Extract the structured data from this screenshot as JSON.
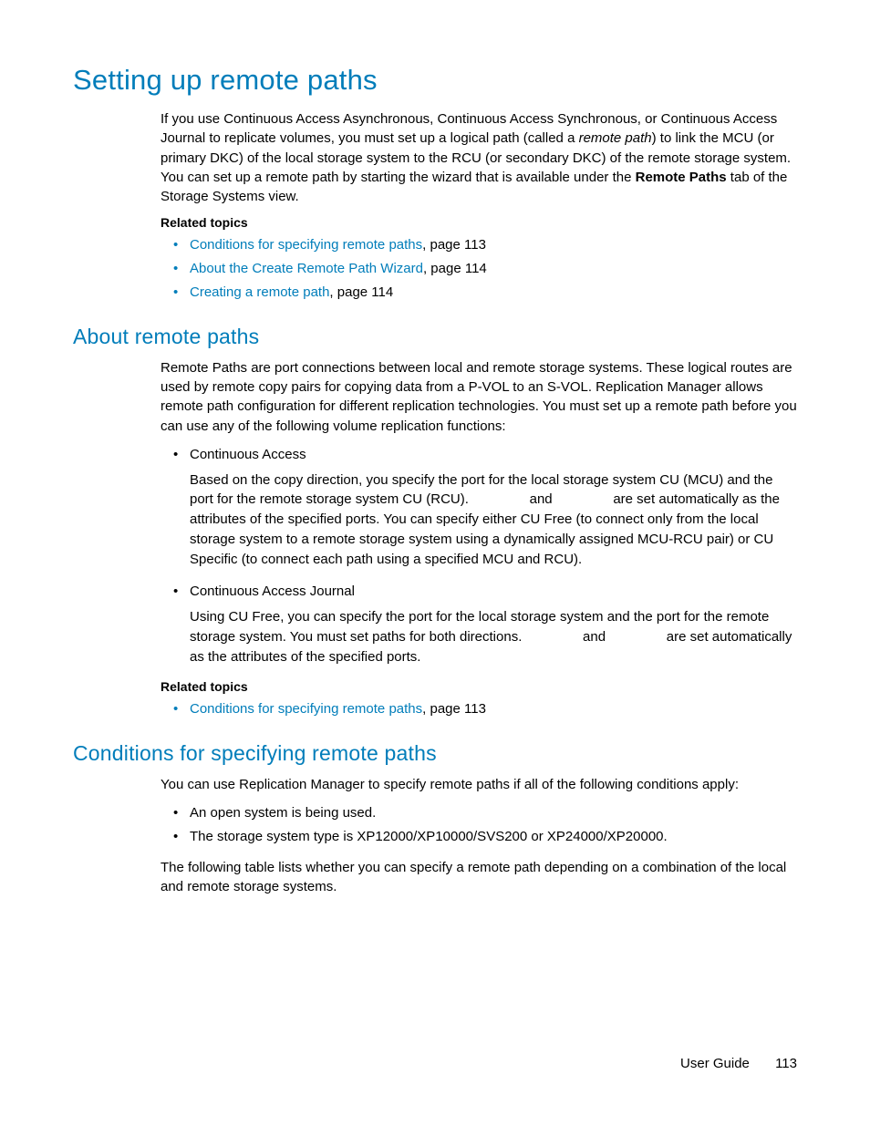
{
  "h1": "Setting up remote paths",
  "intro_a": "If you use Continuous Access Asynchronous, Continuous Access Synchronous, or Continuous Access Journal to replicate volumes, you must set up a logical path (called a ",
  "intro_em": "remote path",
  "intro_b": ") to link the MCU (or primary DKC) of the local storage system to the RCU (or secondary DKC) of the remote storage system. You can set up a remote path by starting the wizard that is available under the ",
  "intro_bold": "Remote Paths",
  "intro_c": " tab of the Storage Systems view.",
  "related": "Related topics",
  "topics1": [
    {
      "link": "Conditions for specifying remote paths",
      "suffix": ", page 113"
    },
    {
      "link": "About the Create Remote Path Wizard",
      "suffix": ", page 114"
    },
    {
      "link": "Creating a remote path",
      "suffix": ", page 114"
    }
  ],
  "h2a": "About remote paths",
  "about_para": "Remote Paths are port connections between local and remote storage systems. These logical routes are used by remote copy pairs for copying data from a P-VOL to an S-VOL. Replication Manager allows remote path configuration for different replication technologies. You must set up a remote path before you can use any of the following volume replication functions:",
  "ca_label": "Continuous Access",
  "ca_text_a": "Based on the copy direction, you specify the port for the local storage system CU (MCU) and the port for the remote storage system CU (RCU).",
  "and": "and",
  "ca_text_b": "are set automatically as the attributes of the specified ports. You can specify either CU Free (to connect only from the local storage system to a remote storage system using a dynamically assigned MCU-RCU pair) or CU Specific (to connect each path using a specified MCU and RCU).",
  "caj_label": "Continuous Access Journal",
  "caj_text_a": "Using CU Free, you can specify the port for the local storage system and the port for the remote storage system. You must set paths for both directions.",
  "caj_text_b": "are set automatically as the attributes of the specified ports.",
  "topics2": [
    {
      "link": "Conditions for specifying remote paths",
      "suffix": ", page 113"
    }
  ],
  "h2b": "Conditions for specifying remote paths",
  "cond_para": "You can use Replication Manager to specify remote paths if all of the following conditions apply:",
  "cond_bullets": [
    "An open system is being used.",
    "The storage system type is XP12000/XP10000/SVS200 or XP24000/XP20000."
  ],
  "cond_after": "The following table lists whether you can specify a remote path depending on a combination of the local and remote storage systems.",
  "footer_label": "User Guide",
  "footer_page": "113",
  "gap": "                "
}
